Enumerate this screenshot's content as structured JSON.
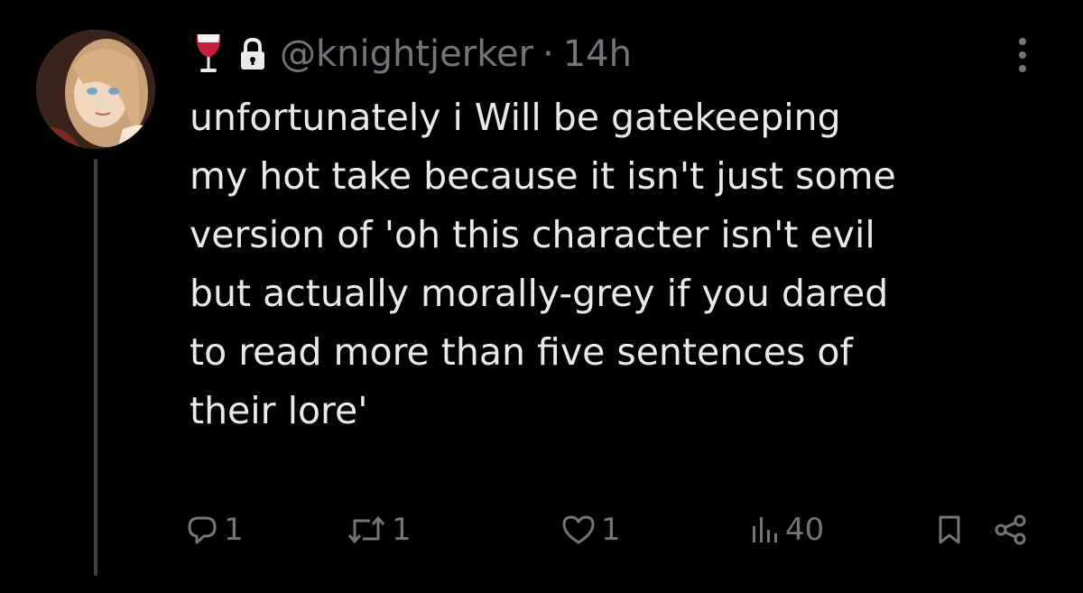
{
  "tweet": {
    "handle": "@knightjerker",
    "separator": "·",
    "time": "14h",
    "text": "unfortunately i Will be gatekeeping\nmy hot take because it isn't just some\nversion of 'oh this character isn't evil\nbut actually morally-grey if you dared\nto read more than five sentences of\ntheir lore'",
    "name_emoji": "wine-glass-icon",
    "protected_icon": "lock-icon"
  },
  "actions": {
    "replies": "1",
    "retweets": "1",
    "likes": "1",
    "views": "40"
  },
  "colors": {
    "background": "#000000",
    "text": "#e7e9ea",
    "muted": "#71767b",
    "thread_line": "#3e4144",
    "wine": "#c41e3a"
  }
}
